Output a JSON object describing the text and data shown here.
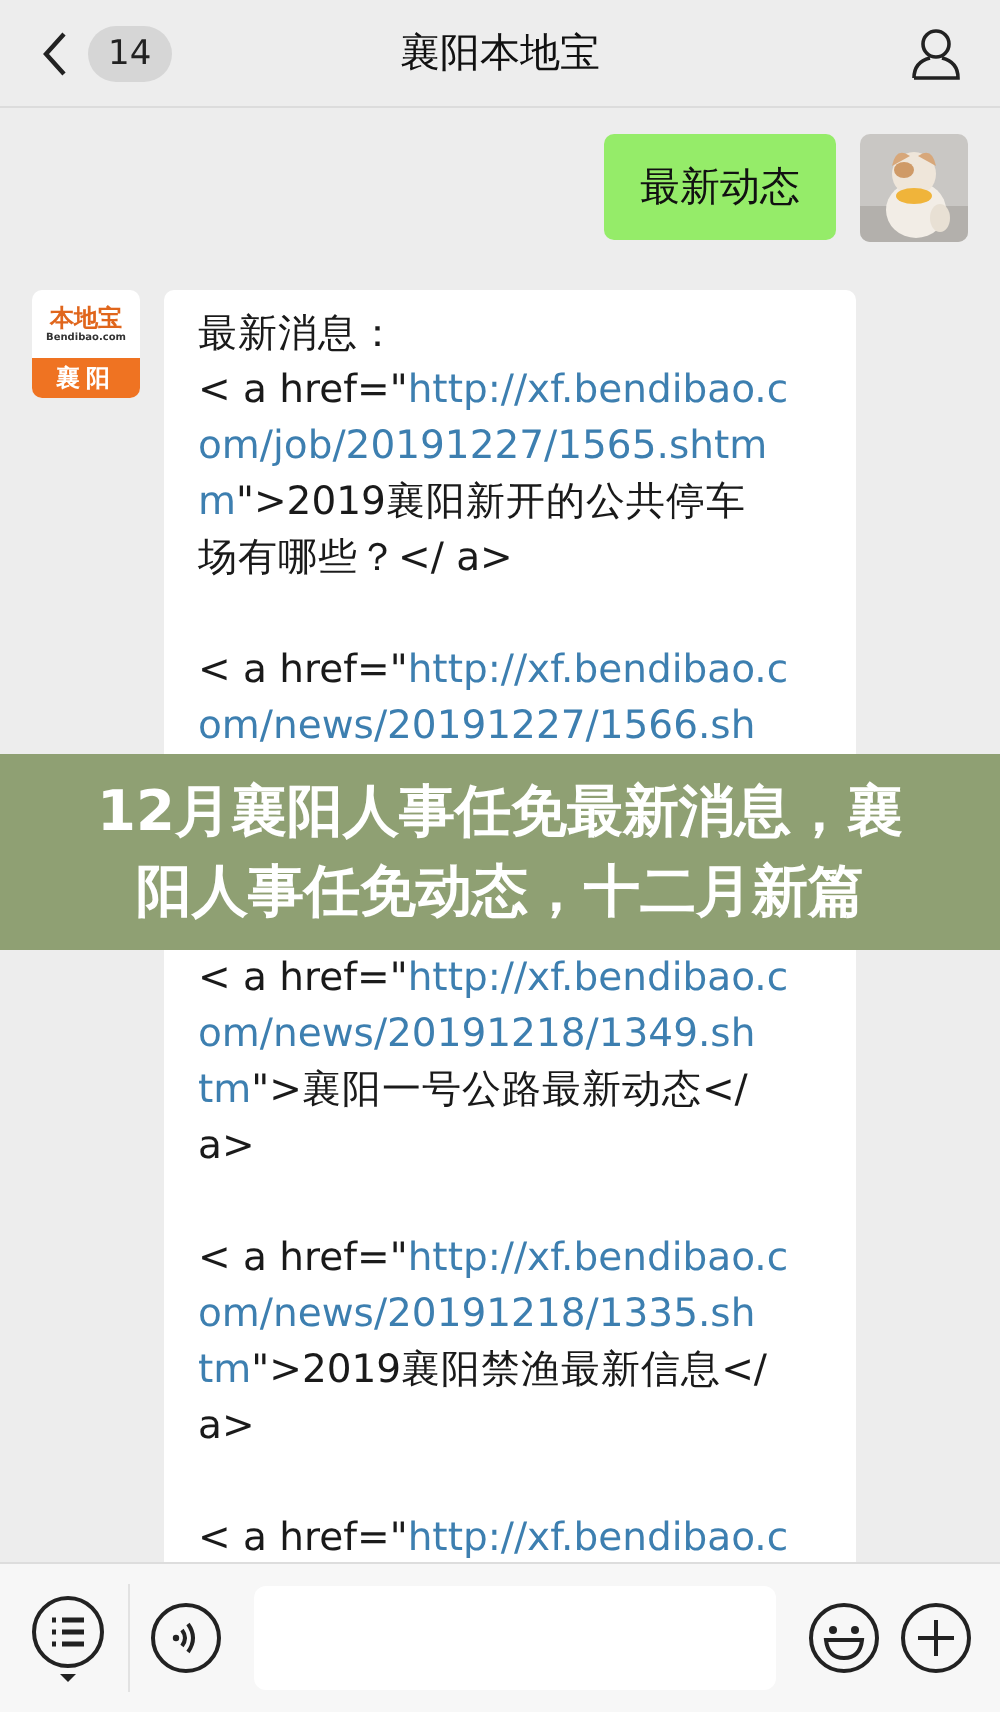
{
  "header": {
    "back_count": "14",
    "title": "襄阳本地宝"
  },
  "messages": [
    {
      "kind": "sent_text",
      "text": "最新动态"
    },
    {
      "kind": "received_links",
      "sender_logo": {
        "brand": "本地宝",
        "site": "Bendibao.com",
        "city": "襄阳"
      },
      "paragraphs": [
        {
          "overlaid": false,
          "lines": [
            [
              {
                "text": "最新消息：",
                "link": false
              }
            ],
            [
              {
                "text": "< a href=\"",
                "link": false
              },
              {
                "text": "http://xf.bendibao.c",
                "link": true
              }
            ],
            [
              {
                "text": "om/job/20191227/1565.shtm",
                "link": true
              }
            ],
            [
              {
                "text": "m",
                "link": true
              },
              {
                "text": "\">2019襄阳新开的公共停车",
                "link": false
              }
            ],
            [
              {
                "text": "场有哪些？</ a>",
                "link": false
              }
            ]
          ]
        },
        {
          "overlaid": true,
          "lines": [
            [
              {
                "text": "< a href=\"",
                "link": false
              },
              {
                "text": "http://xf.bendibao.c",
                "link": true
              }
            ],
            [
              {
                "text": "om/news/20191227/1566.sh",
                "link": true
              }
            ]
          ]
        },
        {
          "overlaid": false,
          "lines": [
            [
              {
                "text": "< a href=\"",
                "link": false
              },
              {
                "text": "http://xf.bendibao.c",
                "link": true
              }
            ],
            [
              {
                "text": "om/news/20191218/1349.sh",
                "link": true
              }
            ],
            [
              {
                "text": "tm",
                "link": true
              },
              {
                "text": "\">襄阳一号公路最新动态</",
                "link": false
              }
            ],
            [
              {
                "text": "a>",
                "link": false
              }
            ]
          ]
        },
        {
          "overlaid": false,
          "lines": [
            [
              {
                "text": "< a href=\"",
                "link": false
              },
              {
                "text": "http://xf.bendibao.c",
                "link": true
              }
            ],
            [
              {
                "text": "om/news/20191218/1335.sh",
                "link": true
              }
            ],
            [
              {
                "text": "tm",
                "link": true
              },
              {
                "text": "\">2019襄阳禁渔最新信息</",
                "link": false
              }
            ],
            [
              {
                "text": "a>",
                "link": false
              }
            ]
          ]
        },
        {
          "overlaid": false,
          "lines": [
            [
              {
                "text": "< a href=\"",
                "link": false
              },
              {
                "text": "http://xf.bendibao.c",
                "link": true
              }
            ]
          ]
        }
      ]
    }
  ],
  "banner": {
    "text": "12月襄阳人事任免最新消息，襄阳人事任免动态，十二月新篇"
  }
}
